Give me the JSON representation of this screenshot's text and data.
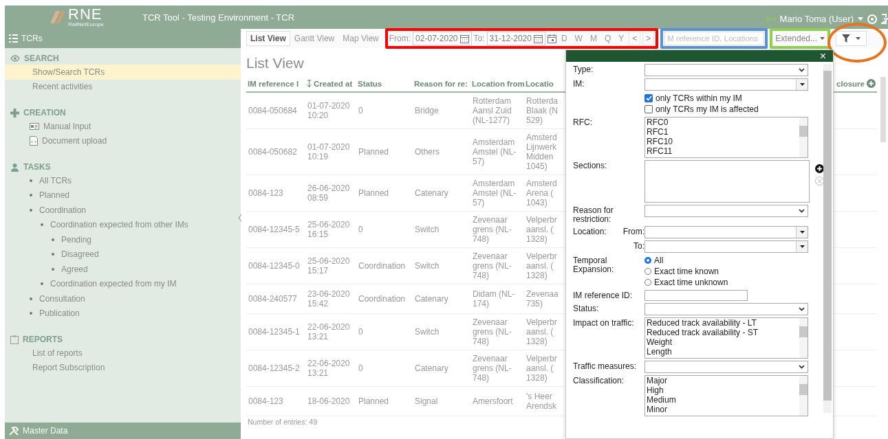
{
  "header": {
    "logo": "RNE",
    "logo_sub": "RailNetEurope",
    "title": "TCR Tool - Testing Environment  -  TCR",
    "user": "Mario Toma (User)"
  },
  "sidebar": {
    "title": "TCRs",
    "sections": [
      {
        "kind": "search",
        "title": "SEARCH",
        "items": [
          {
            "kind": "plain",
            "label": "Show/Search TCRs",
            "selected": true
          },
          {
            "kind": "plain",
            "label": "Recent activities",
            "selected": false
          }
        ]
      },
      {
        "kind": "creation",
        "title": "CREATION",
        "items": [
          {
            "kind": "form",
            "label": "Manual Input",
            "selected": false
          },
          {
            "kind": "document",
            "label": "Document upload",
            "selected": false
          }
        ]
      },
      {
        "kind": "tasks",
        "title": "TASKS",
        "items": [
          {
            "kind": "bullet",
            "label": "All TCRs",
            "selected": false
          },
          {
            "kind": "bullet",
            "label": "Planned",
            "selected": false
          },
          {
            "kind": "bullet",
            "label": "Coordination",
            "selected": false,
            "children": [
              {
                "kind": "bullet",
                "label": "Coordination expected from other IMs",
                "selected": false,
                "children": [
                  {
                    "kind": "bullet",
                    "label": "Pending",
                    "selected": false
                  },
                  {
                    "kind": "bullet",
                    "label": "Disagreed",
                    "selected": false
                  },
                  {
                    "kind": "bullet",
                    "label": "Agreed",
                    "selected": false
                  }
                ]
              },
              {
                "kind": "bullet",
                "label": "Coordination expected from my IM",
                "selected": false
              }
            ]
          },
          {
            "kind": "bullet",
            "label": "Consultation",
            "selected": false
          },
          {
            "kind": "bullet",
            "label": "Publication",
            "selected": false
          }
        ]
      },
      {
        "kind": "reports",
        "title": "REPORTS",
        "items": [
          {
            "kind": "plain",
            "label": "List of reports",
            "selected": false
          },
          {
            "kind": "plain",
            "label": "Report Subscription",
            "selected": false
          }
        ]
      }
    ],
    "footer": "Master Data"
  },
  "toolbar": {
    "tabs": [
      {
        "label": "List View",
        "selected": true
      },
      {
        "label": "Gantt View",
        "selected": false
      },
      {
        "label": "Map View",
        "selected": false
      }
    ],
    "from_label": "From:",
    "from_value": "02-07-2020",
    "to_label": "To:",
    "to_value": "31-12-2020",
    "periods": [
      "D",
      "W",
      "M",
      "Q",
      "Y"
    ],
    "prev": "<",
    "next": ">",
    "search_placeholder": "M reference ID, Locations",
    "view_select": "Extended...",
    "highlights": [
      {
        "kind": "box",
        "color": "#ff0000"
      },
      {
        "kind": "box",
        "color": "#5b8fd6"
      },
      {
        "kind": "box",
        "color": "#8fd14f"
      },
      {
        "kind": "circle",
        "color": "#e8731c"
      }
    ]
  },
  "list": {
    "heading": "List View",
    "columns": [
      "IM reference I",
      "Created at",
      "Status",
      "Reason for re:",
      "Location from",
      "Locatio",
      "closure"
    ],
    "rows": [
      [
        "0084-050684",
        "01-07-2020 10:20",
        "0",
        "Bridge",
        "Rotterdam Aansl Zuid (NL-1277)",
        "Rotterda\nBlaak (N\n529)"
      ],
      [
        "0084-050682",
        "01-07-2020 10:19",
        "Planned",
        "Others",
        "Amsterdam Amstel (NL-57)",
        "Amsterd\nLijnwerk\nMidden\n1045)"
      ],
      [
        "0084-123",
        "26-06-2020 08:59",
        "Planned",
        "Catenary",
        "Amsterdam Amstel (NL-57)",
        "Amsterd\nArena (\n1043)"
      ],
      [
        "0084-12345-5",
        "25-06-2020 16:15",
        "0",
        "Switch",
        "Zevenaar grens (NL-748)",
        "Velperbr\naansl. (\n1328)"
      ],
      [
        "0084-12345-0",
        "25-06-2020 15:17",
        "Coordination",
        "Switch",
        "Zevenaar grens (NL-748)",
        "Velperbr\naansl. (\n1328)"
      ],
      [
        "0084-240577",
        "23-06-2020 15:42",
        "Coordination",
        "Catenary",
        "Didam (NL-174)",
        "Zevenaa\n735)"
      ],
      [
        "0084-12345-1",
        "22-06-2020 13:21",
        "0",
        "Switch",
        "Zevenaar grens (NL-748)",
        "Velperbr\naansl. (\n1328)"
      ],
      [
        "0084-12345-2",
        "22-06-2020 13:21",
        "0",
        "Catenary",
        "Zevenaar grens (NL-748)",
        "Velperbr\naansl. (\n1328)"
      ],
      [
        "0084-123",
        "18-06-2020",
        "Planned",
        "Signal",
        "Amersfoort",
        "'s Heer\nArendsk"
      ]
    ],
    "entries": "Number of entries: 49"
  },
  "filter_panel": {
    "close": "×",
    "fields": [
      {
        "kind": "select",
        "label": "Type:"
      },
      {
        "kind": "combo",
        "label": "IM:"
      },
      {
        "kind": "checks",
        "options": [
          {
            "label": "only TCRs within my IM",
            "checked": true
          },
          {
            "label": "only TCRs my IM is affected",
            "checked": false
          }
        ]
      },
      {
        "kind": "listbox",
        "label": "RFC:",
        "options": [
          "RFC0",
          "RFC1",
          "RFC10",
          "RFC11"
        ]
      },
      {
        "kind": "sections",
        "label": "Sections:"
      },
      {
        "kind": "select",
        "label": "Reason for restriction:"
      },
      {
        "kind": "combo",
        "label": "Location:",
        "sublabel": "From:"
      },
      {
        "kind": "combo",
        "sublabel": "To:"
      },
      {
        "kind": "radios",
        "label": "Temporal Expansion:",
        "options": [
          {
            "label": "All",
            "selected": true
          },
          {
            "label": "Exact time known",
            "selected": false
          },
          {
            "label": "Exact time unknown",
            "selected": false
          }
        ]
      },
      {
        "kind": "text",
        "label": "IM reference ID:"
      },
      {
        "kind": "select",
        "label": "Status:"
      },
      {
        "kind": "listbox",
        "label": "Impact on traffic:",
        "options": [
          "Reduced track availability - LT",
          "Reduced track availability - ST",
          "Weight",
          "Length"
        ]
      },
      {
        "kind": "select",
        "label": "Traffic measures:"
      },
      {
        "kind": "listbox",
        "label": "Classification:",
        "options": [
          "Major",
          "High",
          "Medium",
          "Minor"
        ]
      }
    ]
  }
}
